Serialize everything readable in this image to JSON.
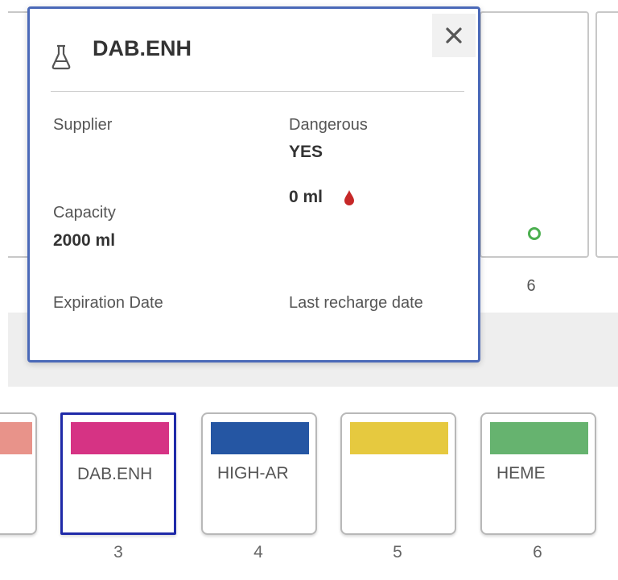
{
  "popup": {
    "title": "DAB.ENH",
    "icon": "flask-icon",
    "close_icon": "close-icon",
    "fields": {
      "supplier_label": "Supplier",
      "dangerous_label": "Dangerous",
      "dangerous_value": "YES",
      "volume_value": "0 ml",
      "capacity_label": "Capacity",
      "capacity_value": "2000 ml",
      "expiration_label": "Expiration Date",
      "last_recharge_label": "Last recharge date"
    },
    "colors": {
      "border": "#4a69b8",
      "drop": "#c62828"
    }
  },
  "top_rack": {
    "visible_number": "6",
    "status_color": "#4caf50"
  },
  "bottom_rack": {
    "slots": [
      {
        "number": "",
        "name": "",
        "color": "#e8938a",
        "selected": false
      },
      {
        "number": "3",
        "name": "DAB.ENH",
        "color": "#d63384",
        "selected": true
      },
      {
        "number": "4",
        "name": "HIGH-AR",
        "color": "#2556a3",
        "selected": false
      },
      {
        "number": "5",
        "name": "",
        "color": "#e6c93f",
        "selected": false
      },
      {
        "number": "6",
        "name": "HEME",
        "color": "#66b36f",
        "selected": false
      }
    ]
  }
}
